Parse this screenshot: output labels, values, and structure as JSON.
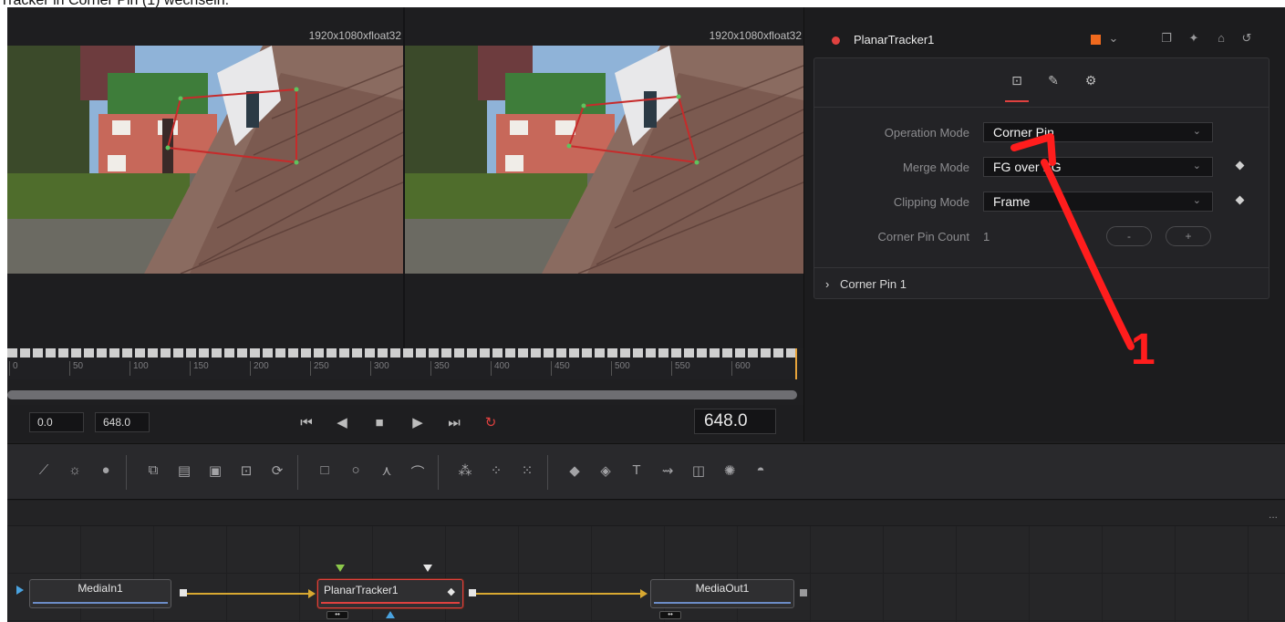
{
  "caption": "Tracker in Corner Pin (1) wechseln.",
  "viewers": {
    "left_res": "1920x1080xfloat32",
    "right_res": "1920x1080xfloat32"
  },
  "ruler": {
    "ticks": [
      "0",
      "50",
      "100",
      "150",
      "200",
      "250",
      "300",
      "350",
      "400",
      "450",
      "500",
      "550",
      "600"
    ]
  },
  "transport": {
    "start": "0.0",
    "end": "648.0",
    "current": "648.0"
  },
  "inspector": {
    "node_name": "PlanarTracker1",
    "color": "#f06a1e",
    "fields": {
      "operation_mode_label": "Operation Mode",
      "operation_mode_value": "Corner Pin",
      "merge_mode_label": "Merge Mode",
      "merge_mode_value": "FG over BG",
      "clipping_mode_label": "Clipping Mode",
      "clipping_mode_value": "Frame",
      "corner_pin_count_label": "Corner Pin Count",
      "corner_pin_count_value": "1",
      "minus": "-",
      "plus": "+"
    },
    "section": "Corner Pin 1"
  },
  "annotation": {
    "number": "1",
    "color": "#ff1d1d"
  },
  "nodes": {
    "media_in": "MediaIn1",
    "planar_tracker": "PlanarTracker1",
    "media_out": "MediaOut1",
    "more": "..."
  }
}
